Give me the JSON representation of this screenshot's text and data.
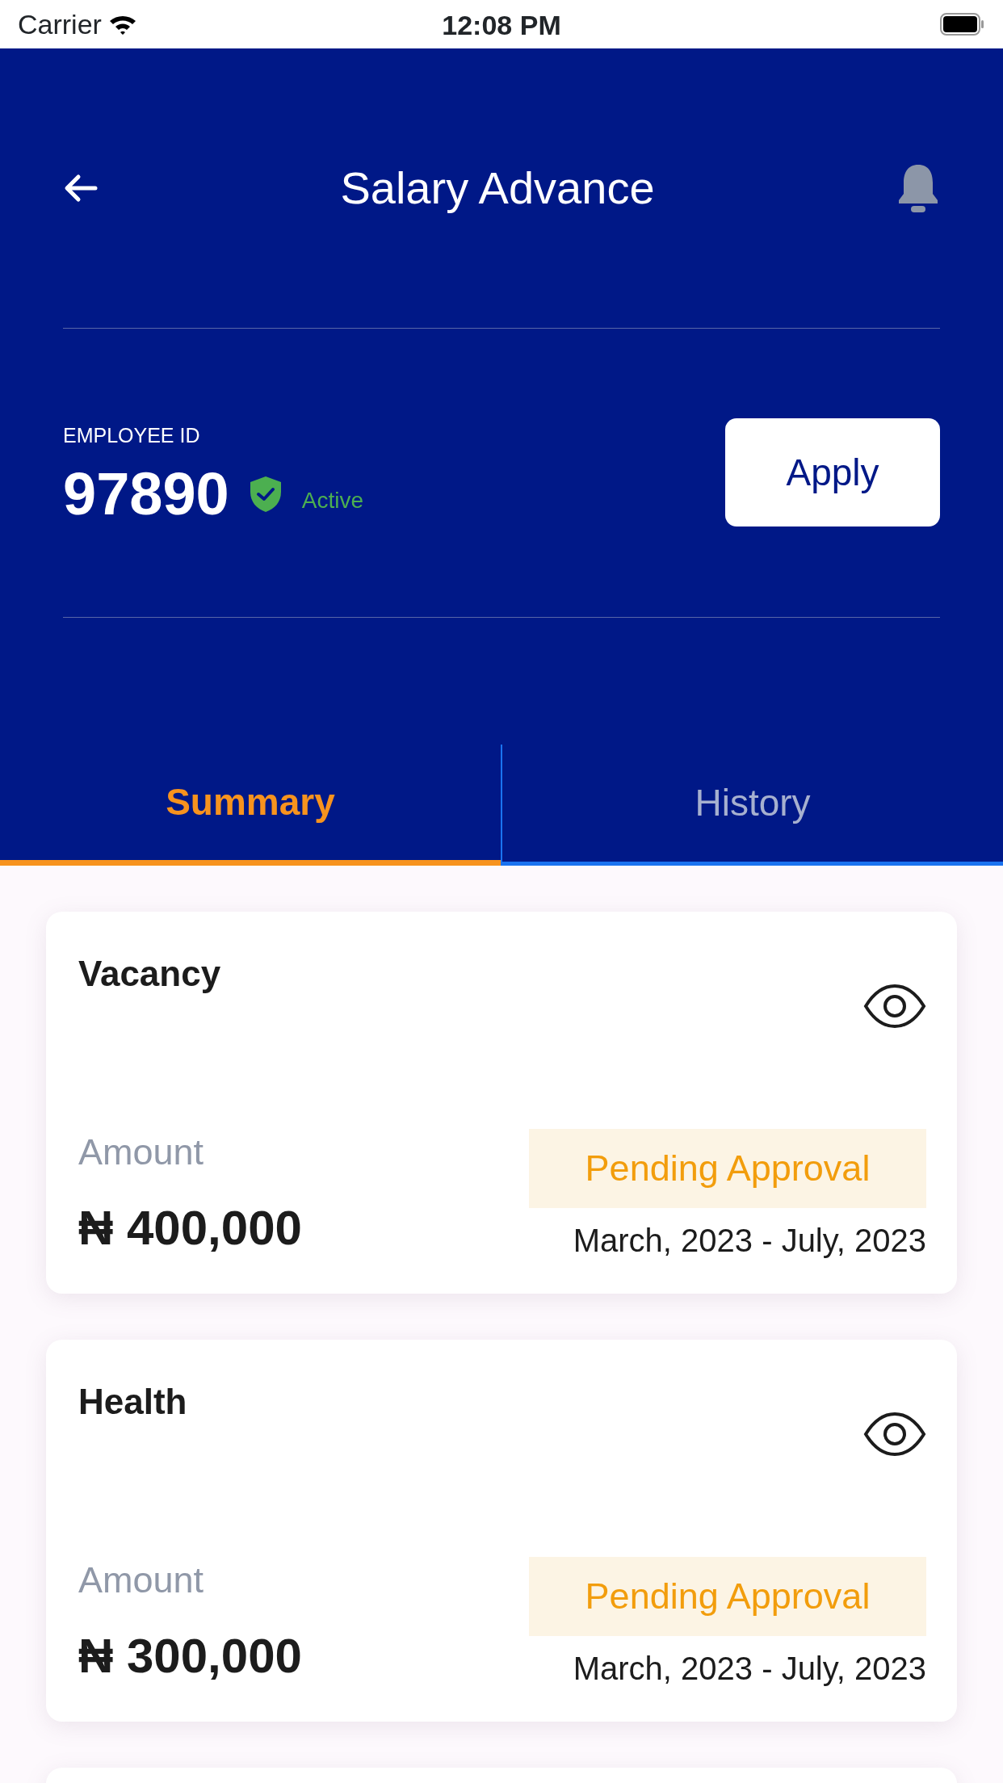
{
  "status_bar": {
    "carrier": "Carrier",
    "time": "12:08 PM"
  },
  "header": {
    "title": "Salary Advance"
  },
  "employee": {
    "label": "EMPLOYEE ID",
    "id": "97890",
    "status": "Active",
    "verified": true
  },
  "apply_button": "Apply",
  "tabs": [
    {
      "label": "Summary",
      "selected": true
    },
    {
      "label": "History",
      "selected": false
    }
  ],
  "cards": [
    {
      "title": "Vacancy",
      "amount_label": "Amount",
      "amount": "₦ 400,000",
      "status": "Pending Approval",
      "period": "March, 2023 - July, 2023"
    },
    {
      "title": "Health",
      "amount_label": "Amount",
      "amount": "₦ 300,000",
      "status": "Pending Approval",
      "period": "March, 2023 - July, 2023"
    }
  ]
}
